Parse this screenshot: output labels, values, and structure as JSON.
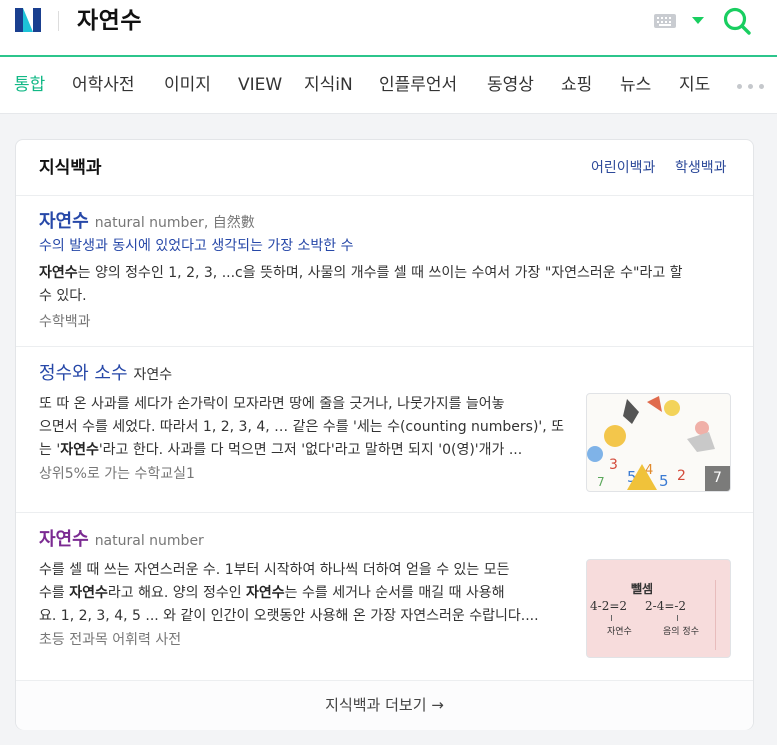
{
  "header": {
    "logo_letter": "N",
    "search_query": "자연수",
    "brand_color": "#19ce60",
    "icons": [
      "naver-logo-icon",
      "keyboard-icon",
      "dropdown-caret-icon",
      "search-icon"
    ]
  },
  "tabs": [
    {
      "label": "통합",
      "active": true
    },
    {
      "label": "어학사전"
    },
    {
      "label": "이미지"
    },
    {
      "label": "VIEW"
    },
    {
      "label": "지식iN"
    },
    {
      "label": "인플루언서"
    },
    {
      "label": "동영상"
    },
    {
      "label": "쇼핑"
    },
    {
      "label": "뉴스"
    },
    {
      "label": "지도"
    }
  ],
  "card": {
    "title": "지식백과",
    "links": [
      "어린이백과",
      "학생백과"
    ],
    "entries": [
      {
        "title": "자연수",
        "title_sub": "natural number, 自然數",
        "subtitle": "수의 발생과 동시에 있었다고 생각되는 가장 소박한 수",
        "body_bold": "자연수",
        "body_line1": "는 양의 정수인 1, 2, 3, ...с을 뜻하며, 사물의 개수를 셀 때 쓰이는 수여서 가장 \"자연스러운 수\"라고 할",
        "body_line2": "수 있다.",
        "source": "수학백과"
      },
      {
        "title": "정수와 소수",
        "title_sub": "자연수",
        "line1": "또 따 온 사과를 세다가 손가락이 모자라면 땅에 줄을 긋거나, 나뭇가지를 늘어놓",
        "line2": "으면서 수를 세었다. 따라서 1, 2, 3, 4, … 같은 수를 '세는 수(counting numbers)', 또",
        "line3_pre": "는 '",
        "line3_bold": "자연수",
        "line3_post": "'라고 한다. 사과를 다 먹으면 그저 '없다'라고 말하면 되지 '0(영)'개가 ...",
        "source": "상위5%로 가는 수학교실1",
        "image_count": "7"
      },
      {
        "title": "자연수",
        "title_sub": "natural number",
        "line1": "수를 셀 때 쓰는 자연스러운 수. 1부터 시작하여 하나씩 더하여 얻을 수 있는 모든",
        "line2_pre": "수를 ",
        "line2_bold": "자연수",
        "line2_post": "라고 해요. 양의 정수인 ",
        "line2_bold2": "자연수",
        "line2_post2": "는 수를 세거나 순서를 매길 때 사용해",
        "line3": "요. 1, 2, 3, 4, 5 ... 와 같이 인간이 오랫동안 사용해 온 가장 자연스러운 수랍니다....",
        "source": "초등 전과목 어휘력 사전",
        "thumb": {
          "heading": "뺄셈",
          "eq1": "4-2=2",
          "eq2": "2-4=-2",
          "label1": "자연수",
          "label2": "음의 정수"
        }
      }
    ],
    "more_label": "지식백과 더보기 →"
  },
  "colors": {
    "active_tab": "#12b886",
    "link_blue": "#2748a8",
    "visited_purple": "#7b2a92"
  }
}
